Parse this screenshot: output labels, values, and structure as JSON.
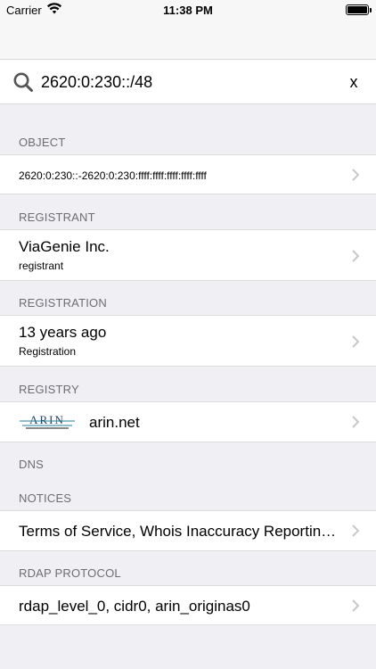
{
  "status_bar": {
    "carrier": "Carrier",
    "time": "11:38 PM"
  },
  "search": {
    "value": "2620:0:230::/48",
    "clear_label": "x"
  },
  "sections": {
    "object": {
      "header": "OBJECT",
      "value": "2620:0:230::-2620:0:230:ffff:ffff:ffff:ffff:ffff"
    },
    "registrant": {
      "header": "REGISTRANT",
      "title": "ViaGenie Inc.",
      "subtitle": "registrant"
    },
    "registration": {
      "header": "REGISTRATION",
      "title": "13 years ago",
      "subtitle": "Registration"
    },
    "registry": {
      "header": "REGISTRY",
      "logo_text": "ARIN",
      "logo_tagline": "American Registry for Internet Numbers",
      "title": "arin.net"
    },
    "dns": {
      "header": "DNS"
    },
    "notices": {
      "header": "NOTICES",
      "title": "Terms of Service, Whois Inaccuracy Reporting, Copyright Notice"
    },
    "rdap_protocol": {
      "header": "RDAP PROTOCOL",
      "title": "rdap_level_0, cidr0, arin_originas0"
    }
  },
  "colors": {
    "background": "#efeff4",
    "section_header": "#6d6d72",
    "chevron": "#c7c7cc",
    "arin_teal": "#1f7f9a"
  },
  "icons": {
    "search": "search-icon",
    "chevron": "chevron-right-icon",
    "wifi": "wifi-icon",
    "battery": "battery-icon"
  }
}
